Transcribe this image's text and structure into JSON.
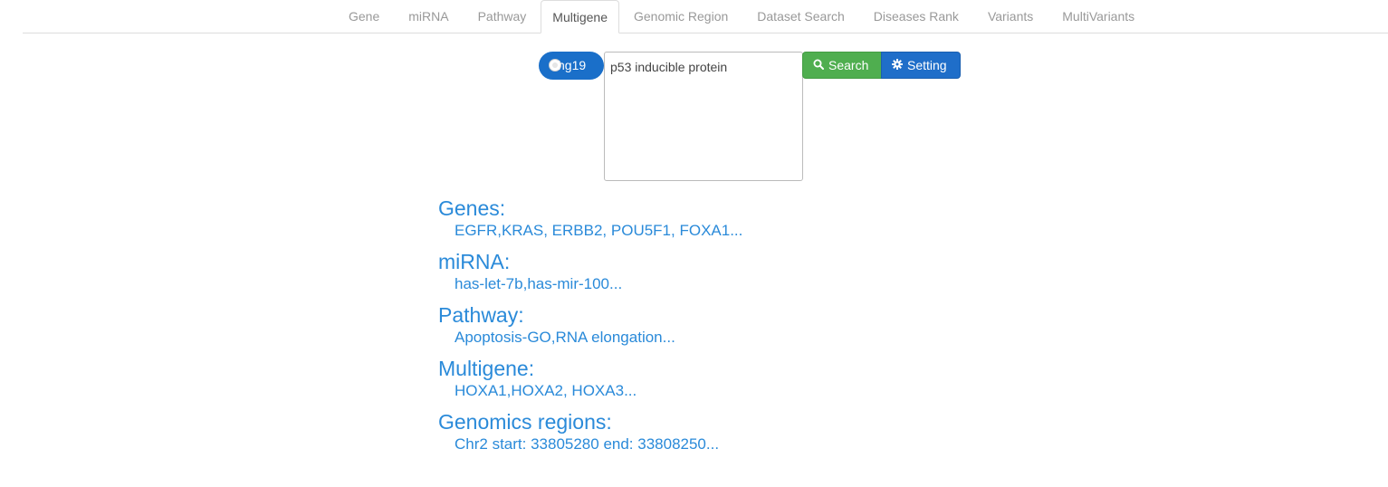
{
  "nav": {
    "tabs": [
      {
        "label": "Gene"
      },
      {
        "label": "miRNA"
      },
      {
        "label": "Pathway"
      },
      {
        "label": "Multigene",
        "active": true
      },
      {
        "label": "Genomic Region"
      },
      {
        "label": "Dataset Search"
      },
      {
        "label": "Diseases Rank"
      },
      {
        "label": "Variants"
      },
      {
        "label": "MultiVariants"
      }
    ]
  },
  "search": {
    "genome_toggle": "hg19",
    "query_value": "p53 inducible protein",
    "search_label": "Search",
    "setting_label": "Setting"
  },
  "examples": [
    {
      "title": "Genes:",
      "value": "EGFR,KRAS, ERBB2, POU5F1, FOXA1..."
    },
    {
      "title": "miRNA:",
      "value": "has-let-7b,has-mir-100..."
    },
    {
      "title": "Pathway:",
      "value": "Apoptosis-GO,RNA elongation..."
    },
    {
      "title": "Multigene:",
      "value": "HOXA1,HOXA2, HOXA3..."
    },
    {
      "title": "Genomics regions:",
      "value": "Chr2 start: 33805280 end: 33808250..."
    }
  ],
  "colors": {
    "accent": "#2a8ad9",
    "search_button": "#4fae4f",
    "setting_button": "#1f6ec9",
    "toggle": "#1a6fc9"
  },
  "icons": {
    "search": "search-icon",
    "setting": "gear-icon"
  }
}
